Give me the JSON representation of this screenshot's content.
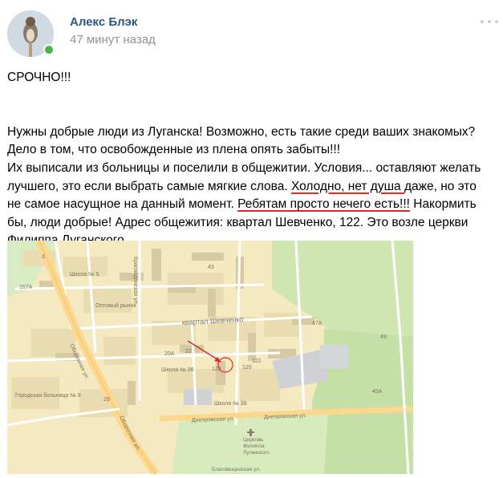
{
  "post": {
    "author": "Алекс Блэк",
    "timestamp": "47 минут назад",
    "urgent": "СРОЧНО!!!",
    "text_lines": [
      "Нужны добрые люди из Луганска! Возможно, есть такие среди ваших знакомых?",
      "Дело в том, что освобожденные из плена опять забыты!!!",
      "Их выписали из больницы и поселили в общежитии. Условия... оставляют желать"
    ],
    "line4_before": "лучшего, это если выбрать самые мягкие слова. ",
    "line4_highlight": "Холодно, нет душа ",
    "line4_after": "даже, но это",
    "line5_before": "не самое насущное на данный момент. ",
    "line5_highlight": "Ребятам просто нечего есть!!!",
    "line5_after": " Накормить",
    "text_lines_end": [
      "бы, люди добрые! Адрес общежития: квартал Шевченко, 122. Это возле церкви",
      "Филиппа Луганского"
    ]
  },
  "map": {
    "labels": {
      "school5": "Школа № 5",
      "market": "Оптовый рынок",
      "quarter": "квартал Шевченко",
      "school38a": "Школа № 38",
      "school38b": "Школа № 38",
      "hospital": "Городская больница № 8",
      "street_dnepr1": "Днепровская ул.",
      "street_dnepr2": "Днепровская ул.",
      "street_oboronnaya1": "Оборонная ул.",
      "street_oboronnaya2": "Оборонная ул.",
      "street_vertical": "Краснодонская ул.",
      "church": "Церковь Филиппа Луганского",
      "church_line1": "Церковь",
      "church_line2": "Филиппа",
      "church_line3": "Луганского",
      "blagovesh": "Благовещенская ул.",
      "num_47a": "47А",
      "num_45a": "45А",
      "num_120": "120",
      "num_121": "121",
      "num_122": "122",
      "num_22": "22",
      "num_20a": "20А",
      "num_157a": "157А",
      "num_43": "43",
      "num_49": "49",
      "num_29": "29",
      "num_3": "3"
    }
  },
  "colors": {
    "author_link": "#2a5885",
    "timestamp": "#939393",
    "online": "#4bb34b",
    "underline": "#d92b2b",
    "map_arrow": "#d92b2b"
  }
}
